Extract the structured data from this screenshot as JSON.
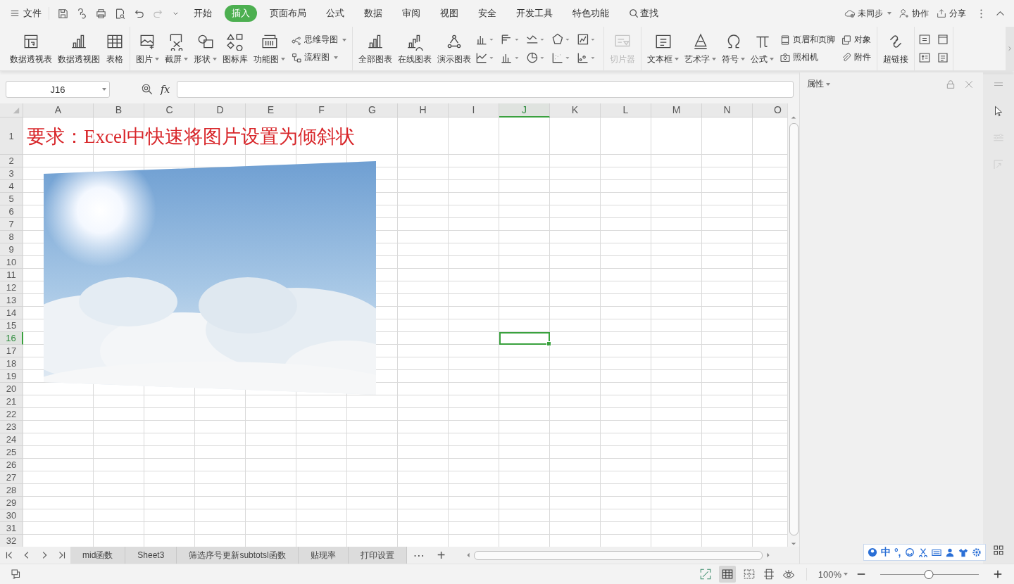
{
  "menu": {
    "file": "文件",
    "tabs": [
      {
        "label": "开始",
        "selected": false
      },
      {
        "label": "插入",
        "selected": true
      },
      {
        "label": "页面布局",
        "selected": false
      },
      {
        "label": "公式",
        "selected": false
      },
      {
        "label": "数据",
        "selected": false
      },
      {
        "label": "审阅",
        "selected": false
      },
      {
        "label": "视图",
        "selected": false
      },
      {
        "label": "安全",
        "selected": false
      },
      {
        "label": "开发工具",
        "selected": false
      },
      {
        "label": "特色功能",
        "selected": false
      }
    ],
    "search": "查找",
    "sync": "未同步",
    "collab": "协作",
    "share": "分享"
  },
  "ribbon": {
    "groups": [
      {
        "items": [
          {
            "kind": "big",
            "label": "数据透视表",
            "dropdown": false,
            "disabled": false
          },
          {
            "kind": "big",
            "label": "数据透视图",
            "dropdown": false,
            "disabled": false
          },
          {
            "kind": "big",
            "label": "表格",
            "dropdown": false,
            "disabled": false
          }
        ]
      },
      {
        "items": [
          {
            "kind": "big",
            "label": "图片",
            "dropdown": true,
            "disabled": false
          },
          {
            "kind": "big",
            "label": "截屏",
            "dropdown": true,
            "disabled": false
          },
          {
            "kind": "big",
            "label": "形状",
            "dropdown": true,
            "disabled": false
          },
          {
            "kind": "big",
            "label": "图标库",
            "dropdown": false,
            "disabled": false
          },
          {
            "kind": "big",
            "label": "功能图",
            "dropdown": true,
            "disabled": false
          },
          {
            "kind": "stack",
            "items": [
              {
                "label": "思维导图",
                "dropdown": true
              },
              {
                "label": "流程图",
                "dropdown": true
              }
            ]
          }
        ]
      },
      {
        "items": [
          {
            "kind": "big",
            "label": "全部图表",
            "dropdown": false,
            "disabled": false
          },
          {
            "kind": "big",
            "label": "在线图表",
            "dropdown": false,
            "disabled": false
          },
          {
            "kind": "big",
            "label": "演示图表",
            "dropdown": false,
            "disabled": false
          },
          {
            "kind": "chart_grid"
          }
        ]
      },
      {
        "items": [
          {
            "kind": "big",
            "label": "切片器",
            "dropdown": false,
            "disabled": true
          }
        ]
      },
      {
        "items": [
          {
            "kind": "big",
            "label": "文本框",
            "dropdown": true,
            "disabled": false
          },
          {
            "kind": "big",
            "label": "艺术字",
            "dropdown": true,
            "disabled": false
          },
          {
            "kind": "big",
            "label": "符号",
            "dropdown": true,
            "disabled": false
          },
          {
            "kind": "big",
            "label": "公式",
            "dropdown": true,
            "disabled": false
          },
          {
            "kind": "stack",
            "items": [
              {
                "label": "页眉和页脚",
                "dropdown": false
              },
              {
                "label": "照相机",
                "dropdown": false
              }
            ]
          },
          {
            "kind": "stack",
            "items": [
              {
                "label": "对象",
                "dropdown": false
              },
              {
                "label": "附件",
                "dropdown": false
              }
            ]
          }
        ]
      },
      {
        "items": [
          {
            "kind": "big",
            "label": "超链接",
            "dropdown": false,
            "disabled": false
          }
        ]
      },
      {
        "items": [
          {
            "kind": "icon_grid"
          }
        ]
      }
    ]
  },
  "formula_bar": {
    "name_box": "J16",
    "fx": "fx"
  },
  "sheet": {
    "columns": [
      {
        "label": "A",
        "selected": false
      },
      {
        "label": "B",
        "selected": false
      },
      {
        "label": "C",
        "selected": false
      },
      {
        "label": "D",
        "selected": false
      },
      {
        "label": "E",
        "selected": false
      },
      {
        "label": "F",
        "selected": false
      },
      {
        "label": "G",
        "selected": false
      },
      {
        "label": "H",
        "selected": false
      },
      {
        "label": "I",
        "selected": false
      },
      {
        "label": "J",
        "selected": true
      },
      {
        "label": "K",
        "selected": false
      },
      {
        "label": "L",
        "selected": false
      },
      {
        "label": "M",
        "selected": false
      },
      {
        "label": "N",
        "selected": false
      },
      {
        "label": "O",
        "selected": false
      }
    ],
    "rows": [
      {
        "label": "1",
        "selected": false
      },
      {
        "label": "2",
        "selected": false
      },
      {
        "label": "3",
        "selected": false
      },
      {
        "label": "4",
        "selected": false
      },
      {
        "label": "5",
        "selected": false
      },
      {
        "label": "6",
        "selected": false
      },
      {
        "label": "7",
        "selected": false
      },
      {
        "label": "8",
        "selected": false
      },
      {
        "label": "9",
        "selected": false
      },
      {
        "label": "10",
        "selected": false
      },
      {
        "label": "11",
        "selected": false
      },
      {
        "label": "12",
        "selected": false
      },
      {
        "label": "13",
        "selected": false
      },
      {
        "label": "14",
        "selected": false
      },
      {
        "label": "15",
        "selected": false
      },
      {
        "label": "16",
        "selected": true
      },
      {
        "label": "17",
        "selected": false
      },
      {
        "label": "18",
        "selected": false
      },
      {
        "label": "19",
        "selected": false
      },
      {
        "label": "20",
        "selected": false
      },
      {
        "label": "21",
        "selected": false
      },
      {
        "label": "22",
        "selected": false
      },
      {
        "label": "23",
        "selected": false
      },
      {
        "label": "24",
        "selected": false
      },
      {
        "label": "25",
        "selected": false
      },
      {
        "label": "26",
        "selected": false
      },
      {
        "label": "27",
        "selected": false
      },
      {
        "label": "28",
        "selected": false
      },
      {
        "label": "29",
        "selected": false
      },
      {
        "label": "30",
        "selected": false
      },
      {
        "label": "31",
        "selected": false
      },
      {
        "label": "32",
        "selected": false
      }
    ],
    "a1": "要求：Excel中快速将图片设置为倾斜状"
  },
  "sheet_tabs": [
    {
      "label": "mid函数",
      "selected": false
    },
    {
      "label": "Sheet3",
      "selected": false
    },
    {
      "label": "筛选序号更新subtotsl函数",
      "selected": false
    },
    {
      "label": "贴现率",
      "selected": false
    },
    {
      "label": "打印设置",
      "selected": false
    }
  ],
  "sheet_tab_more": "⋯",
  "sheet_tab_add": "+",
  "panel": {
    "title": "属性"
  },
  "ime": {
    "mode": "中",
    "punct": "°,"
  },
  "status_bar": {
    "zoom": "100%",
    "level": 0.49
  }
}
